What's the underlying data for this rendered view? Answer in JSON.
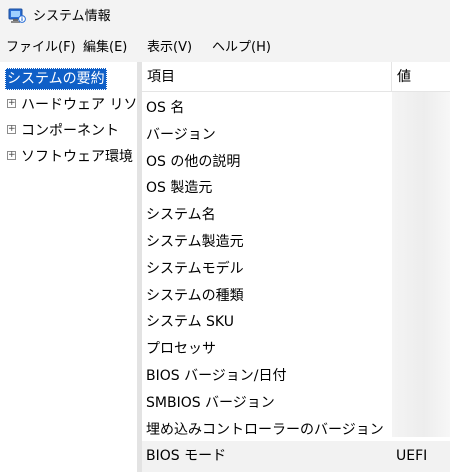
{
  "window": {
    "title": "システム情報",
    "icon": "system-information-icon"
  },
  "menu": [
    {
      "label": "ファイル(F)"
    },
    {
      "label": "編集(E)"
    },
    {
      "label": "表示(V)"
    },
    {
      "label": "ヘルプ(H)"
    }
  ],
  "tree": {
    "root": "システムの要約",
    "children": [
      {
        "label": "ハードウェア リソース",
        "expander": "+"
      },
      {
        "label": "コンポーネント",
        "expander": "+"
      },
      {
        "label": "ソフトウェア環境",
        "expander": "+"
      }
    ]
  },
  "table": {
    "headers": {
      "item": "項目",
      "value": "値"
    },
    "rows": [
      {
        "item": "OS 名",
        "value": ""
      },
      {
        "item": "バージョン",
        "value": ""
      },
      {
        "item": "OS の他の説明",
        "value": ""
      },
      {
        "item": "OS 製造元",
        "value": ""
      },
      {
        "item": "システム名",
        "value": ""
      },
      {
        "item": "システム製造元",
        "value": ""
      },
      {
        "item": "システムモデル",
        "value": ""
      },
      {
        "item": "システムの種類",
        "value": ""
      },
      {
        "item": "システム SKU",
        "value": ""
      },
      {
        "item": "プロセッサ",
        "value": ""
      },
      {
        "item": "BIOS バージョン/日付",
        "value": ""
      },
      {
        "item": "SMBIOS バージョン",
        "value": ""
      },
      {
        "item": "埋め込みコントローラーのバージョン",
        "value": ""
      },
      {
        "item": "BIOS モード",
        "value": "UEFI"
      }
    ]
  },
  "colors": {
    "selection": "#0f5fc7",
    "chrome": "#f3f3f3"
  }
}
